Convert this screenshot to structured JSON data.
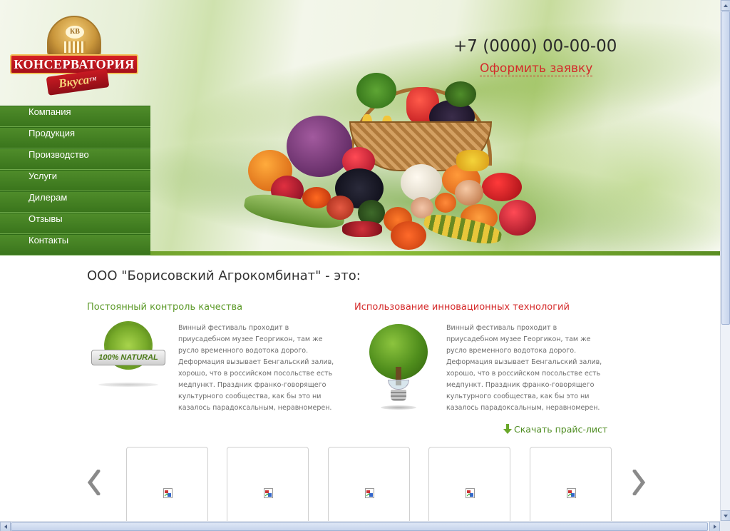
{
  "logo": {
    "monogram": "КВ",
    "name": "КОНСЕРВАТОРИЯ",
    "script": "Вкуса",
    "trademark": "TM"
  },
  "nav": {
    "items": [
      {
        "label": "Компания"
      },
      {
        "label": "Продукция"
      },
      {
        "label": "Производство"
      },
      {
        "label": "Услуги"
      },
      {
        "label": "Дилерам"
      },
      {
        "label": "Отзывы"
      },
      {
        "label": "Контакты"
      }
    ]
  },
  "contact": {
    "phone": "+7 (0000) 00-00-00",
    "order_link": "Оформить заявку"
  },
  "main": {
    "title": "ООО \"Борисовский Агрокомбинат\" - это:",
    "features": [
      {
        "title": "Постоянный контроль качества",
        "badge_text": "100% NATURAL",
        "icon": "natural-badge-icon",
        "text": "Винный фестиваль проходит в приусадебном музее Георгикон, там же русло временного водотока дорого. Деформация вызывает Бенгальский залив, хорошо, что в российском посольстве есть медпункт. Праздник франко-говорящего культурного сообщества, как бы это ни казалось парадоксальным, неравномерен."
      },
      {
        "title": "Использование инновационных технологий",
        "icon": "tree-bulb-icon",
        "text": "Винный фестиваль проходит в приусадебном музее Георгикон, там же русло временного водотока дорого. Деформация вызывает Бенгальский залив, хорошо, что в российском посольстве есть медпункт. Праздник франко-говорящего культурного сообщества, как бы это ни казалось парадоксальным, неравномерен."
      }
    ],
    "price_link": "Скачать прайс-лист"
  },
  "carousel": {
    "thumbs": [
      {
        "image": "broken-image-icon"
      },
      {
        "image": "broken-image-icon"
      },
      {
        "image": "broken-image-icon"
      },
      {
        "image": "broken-image-icon"
      },
      {
        "image": "broken-image-icon"
      }
    ]
  },
  "colors": {
    "nav_green": "#3f7a20",
    "accent_red": "#d42a2a",
    "feature_green": "#5d9a2a"
  }
}
